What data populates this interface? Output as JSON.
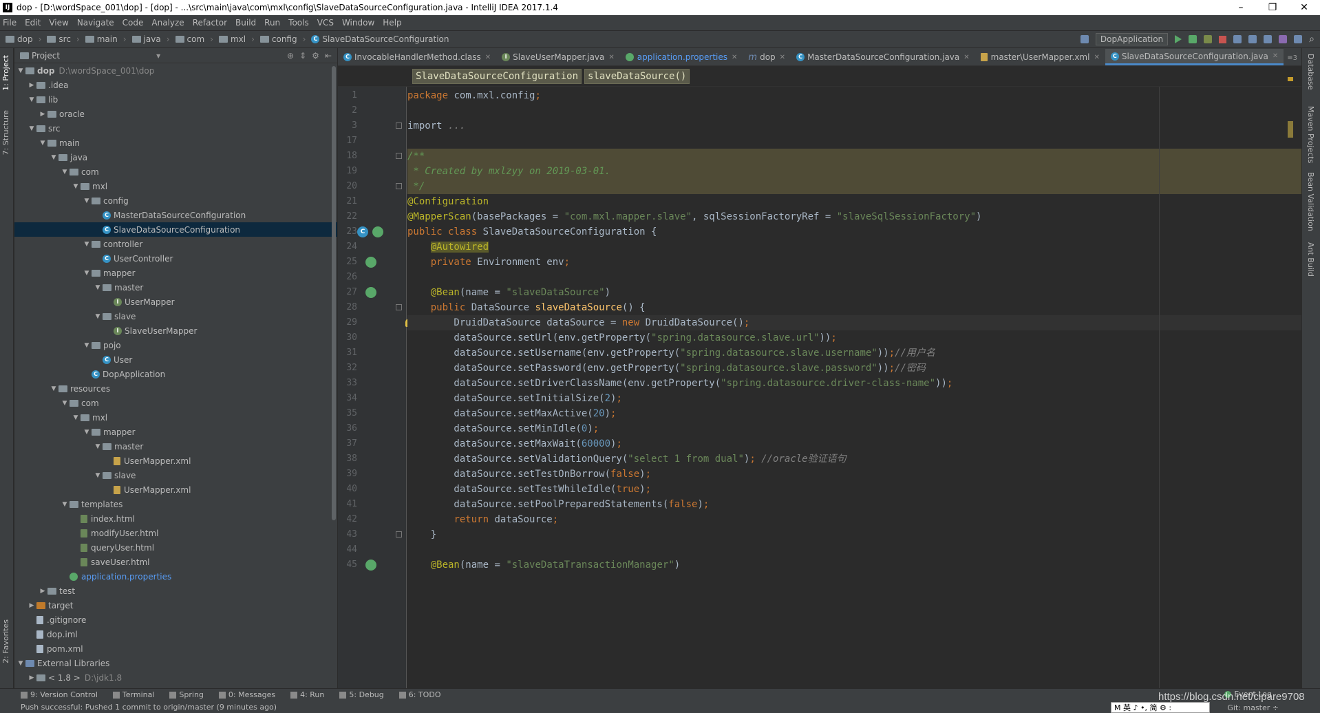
{
  "window": {
    "title": "dop - [D:\\wordSpace_001\\dop] - [dop] - ...\\src\\main\\java\\com\\mxl\\config\\SlaveDataSourceConfiguration.java - IntelliJ IDEA 2017.1.4",
    "app_icon": "IJ"
  },
  "menu": [
    "File",
    "Edit",
    "View",
    "Navigate",
    "Code",
    "Analyze",
    "Refactor",
    "Build",
    "Run",
    "Tools",
    "VCS",
    "Window",
    "Help"
  ],
  "breadcrumbs": [
    "dop",
    "src",
    "main",
    "java",
    "com",
    "mxl",
    "config",
    "SlaveDataSourceConfiguration"
  ],
  "run_config": "DopApplication",
  "project_panel": {
    "title": "Project",
    "tree": [
      {
        "label": "dop",
        "path": "D:\\wordSpace_001\\dop",
        "depth": 0,
        "arrow": "▼",
        "icon": "folder",
        "bold": true
      },
      {
        "label": ".idea",
        "depth": 1,
        "arrow": "▶",
        "icon": "folder"
      },
      {
        "label": "lib",
        "depth": 1,
        "arrow": "▼",
        "icon": "folder"
      },
      {
        "label": "oracle",
        "depth": 2,
        "arrow": "▶",
        "icon": "folder"
      },
      {
        "label": "src",
        "depth": 1,
        "arrow": "▼",
        "icon": "folder"
      },
      {
        "label": "main",
        "depth": 2,
        "arrow": "▼",
        "icon": "folder"
      },
      {
        "label": "java",
        "depth": 3,
        "arrow": "▼",
        "icon": "folder"
      },
      {
        "label": "com",
        "depth": 4,
        "arrow": "▼",
        "icon": "folder"
      },
      {
        "label": "mxl",
        "depth": 5,
        "arrow": "▼",
        "icon": "folder"
      },
      {
        "label": "config",
        "depth": 6,
        "arrow": "▼",
        "icon": "folder"
      },
      {
        "label": "MasterDataSourceConfiguration",
        "depth": 7,
        "arrow": "",
        "icon": "class"
      },
      {
        "label": "SlaveDataSourceConfiguration",
        "depth": 7,
        "arrow": "",
        "icon": "class",
        "selected": true
      },
      {
        "label": "controller",
        "depth": 6,
        "arrow": "▼",
        "icon": "folder"
      },
      {
        "label": "UserController",
        "depth": 7,
        "arrow": "",
        "icon": "class"
      },
      {
        "label": "mapper",
        "depth": 6,
        "arrow": "▼",
        "icon": "folder"
      },
      {
        "label": "master",
        "depth": 7,
        "arrow": "▼",
        "icon": "folder"
      },
      {
        "label": "UserMapper",
        "depth": 8,
        "arrow": "",
        "icon": "interface"
      },
      {
        "label": "slave",
        "depth": 7,
        "arrow": "▼",
        "icon": "folder"
      },
      {
        "label": "SlaveUserMapper",
        "depth": 8,
        "arrow": "",
        "icon": "interface"
      },
      {
        "label": "pojo",
        "depth": 6,
        "arrow": "▼",
        "icon": "folder"
      },
      {
        "label": "User",
        "depth": 7,
        "arrow": "",
        "icon": "class"
      },
      {
        "label": "DopApplication",
        "depth": 6,
        "arrow": "",
        "icon": "class"
      },
      {
        "label": "resources",
        "depth": 3,
        "arrow": "▼",
        "icon": "folder"
      },
      {
        "label": "com",
        "depth": 4,
        "arrow": "▼",
        "icon": "folder"
      },
      {
        "label": "mxl",
        "depth": 5,
        "arrow": "▼",
        "icon": "folder"
      },
      {
        "label": "mapper",
        "depth": 6,
        "arrow": "▼",
        "icon": "folder"
      },
      {
        "label": "master",
        "depth": 7,
        "arrow": "▼",
        "icon": "folder"
      },
      {
        "label": "UserMapper.xml",
        "depth": 8,
        "arrow": "",
        "icon": "xml"
      },
      {
        "label": "slave",
        "depth": 7,
        "arrow": "▼",
        "icon": "folder"
      },
      {
        "label": "UserMapper.xml",
        "depth": 8,
        "arrow": "",
        "icon": "xml"
      },
      {
        "label": "templates",
        "depth": 4,
        "arrow": "▼",
        "icon": "folder"
      },
      {
        "label": "index.html",
        "depth": 5,
        "arrow": "",
        "icon": "html"
      },
      {
        "label": "modifyUser.html",
        "depth": 5,
        "arrow": "",
        "icon": "html"
      },
      {
        "label": "queryUser.html",
        "depth": 5,
        "arrow": "",
        "icon": "html"
      },
      {
        "label": "saveUser.html",
        "depth": 5,
        "arrow": "",
        "icon": "html"
      },
      {
        "label": "application.properties",
        "depth": 4,
        "arrow": "",
        "icon": "props",
        "link": true
      },
      {
        "label": "test",
        "depth": 2,
        "arrow": "▶",
        "icon": "folder"
      },
      {
        "label": "target",
        "depth": 1,
        "arrow": "▶",
        "icon": "orangefolder"
      },
      {
        "label": ".gitignore",
        "depth": 1,
        "arrow": "",
        "icon": "file"
      },
      {
        "label": "dop.iml",
        "depth": 1,
        "arrow": "",
        "icon": "file"
      },
      {
        "label": "pom.xml",
        "depth": 1,
        "arrow": "",
        "icon": "file"
      },
      {
        "label": "External Libraries",
        "depth": 0,
        "arrow": "▼",
        "icon": "lib"
      },
      {
        "label": "< 1.8 >",
        "path": "D:\\jdk1.8",
        "depth": 1,
        "arrow": "▶",
        "icon": "folder"
      }
    ]
  },
  "tabs": [
    {
      "label": "InvocableHandlerMethod.class",
      "icon": "class"
    },
    {
      "label": "SlaveUserMapper.java",
      "icon": "interface"
    },
    {
      "label": "application.properties",
      "icon": "props"
    },
    {
      "label": "dop",
      "icon": "m"
    },
    {
      "label": "MasterDataSourceConfiguration.java",
      "icon": "class"
    },
    {
      "label": "master\\UserMapper.xml",
      "icon": "xml"
    },
    {
      "label": "SlaveDataSourceConfiguration.java",
      "icon": "class",
      "active": true
    }
  ],
  "tabs_overflow": "≡3",
  "editor_breadcrumb": [
    "SlaveDataSourceConfiguration",
    "slaveDataSource()"
  ],
  "line_numbers": [
    "1",
    "2",
    "3",
    "17",
    "18",
    "19",
    "20",
    "21",
    "22",
    "23",
    "24",
    "25",
    "26",
    "27",
    "28",
    "29",
    "30",
    "31",
    "32",
    "33",
    "34",
    "35",
    "36",
    "37",
    "38",
    "39",
    "40",
    "41",
    "42",
    "43",
    "44",
    "45"
  ],
  "code_lines": [
    [
      [
        "k",
        "package "
      ],
      [
        "",
        "com.mxl.config"
      ],
      [
        "k",
        ";"
      ]
    ],
    [],
    [
      [
        "",
        "import "
      ],
      [
        "c",
        "..."
      ]
    ],
    [],
    [
      [
        "cc",
        "/**"
      ]
    ],
    [
      [
        "cc",
        " * Created by mxlzyy on 2019-03-01."
      ]
    ],
    [
      [
        "cc",
        " */"
      ]
    ],
    [
      [
        "a",
        "@Configuration"
      ]
    ],
    [
      [
        "a",
        "@MapperScan"
      ],
      [
        "",
        "(basePackages = "
      ],
      [
        "s",
        "\"com.mxl.mapper.slave\""
      ],
      [
        "",
        ", sqlSessionFactoryRef = "
      ],
      [
        "s",
        "\"slaveSqlSessionFactory\""
      ],
      [
        "",
        ")"
      ]
    ],
    [
      [
        "k",
        "public class "
      ],
      [
        "",
        "SlaveDataSourceConfiguration {"
      ]
    ],
    [
      [
        "",
        "    "
      ],
      [
        "aw",
        "@Autowired"
      ]
    ],
    [
      [
        "",
        "    "
      ],
      [
        "k",
        "private "
      ],
      [
        "",
        "Environment env"
      ],
      [
        "k",
        ";"
      ]
    ],
    [],
    [
      [
        "",
        "    "
      ],
      [
        "a",
        "@Bean"
      ],
      [
        "",
        "(name = "
      ],
      [
        "s",
        "\"slaveDataSource\""
      ],
      [
        "",
        ")"
      ]
    ],
    [
      [
        "",
        "    "
      ],
      [
        "k",
        "public "
      ],
      [
        "",
        "DataSource "
      ],
      [
        "f",
        "slaveDataSource"
      ],
      [
        "",
        "() {"
      ]
    ],
    [
      [
        "",
        "        DruidDataSource dataSource = "
      ],
      [
        "k",
        "new "
      ],
      [
        "",
        "DruidDataSource()"
      ],
      [
        "k",
        ";"
      ]
    ],
    [
      [
        "",
        "        dataSource.setUrl(env.getProperty("
      ],
      [
        "s",
        "\"spring.datasource.slave.url\""
      ],
      [
        "",
        "))"
      ],
      [
        "k",
        ";"
      ]
    ],
    [
      [
        "",
        "        dataSource.setUsername(env.getProperty("
      ],
      [
        "s",
        "\"spring.datasource.slave.username\""
      ],
      [
        "",
        "))"
      ],
      [
        "k",
        ";"
      ],
      [
        "c",
        "//用户名"
      ]
    ],
    [
      [
        "",
        "        dataSource.setPassword(env.getProperty("
      ],
      [
        "s",
        "\"spring.datasource.slave.password\""
      ],
      [
        "",
        "))"
      ],
      [
        "k",
        ";"
      ],
      [
        "c",
        "//密码"
      ]
    ],
    [
      [
        "",
        "        dataSource.setDriverClassName(env.getProperty("
      ],
      [
        "s",
        "\"spring.datasource.driver-class-name\""
      ],
      [
        "",
        "))"
      ],
      [
        "k",
        ";"
      ]
    ],
    [
      [
        "",
        "        dataSource.setInitialSize("
      ],
      [
        "n",
        "2"
      ],
      [
        "",
        ")"
      ],
      [
        "k",
        ";"
      ]
    ],
    [
      [
        "",
        "        dataSource.setMaxActive("
      ],
      [
        "n",
        "20"
      ],
      [
        "",
        ")"
      ],
      [
        "k",
        ";"
      ]
    ],
    [
      [
        "",
        "        dataSource.setMinIdle("
      ],
      [
        "n",
        "0"
      ],
      [
        "",
        ")"
      ],
      [
        "k",
        ";"
      ]
    ],
    [
      [
        "",
        "        dataSource.setMaxWait("
      ],
      [
        "n",
        "60000"
      ],
      [
        "",
        ")"
      ],
      [
        "k",
        ";"
      ]
    ],
    [
      [
        "",
        "        dataSource.setValidationQuery("
      ],
      [
        "s",
        "\"select 1 from dual\""
      ],
      [
        "",
        ")"
      ],
      [
        "k",
        "; "
      ],
      [
        "c",
        "//oracle验证语句"
      ]
    ],
    [
      [
        "",
        "        dataSource.setTestOnBorrow("
      ],
      [
        "k",
        "false"
      ],
      [
        "",
        ")"
      ],
      [
        "k",
        ";"
      ]
    ],
    [
      [
        "",
        "        dataSource.setTestWhileIdle("
      ],
      [
        "k",
        "true"
      ],
      [
        "",
        ")"
      ],
      [
        "k",
        ";"
      ]
    ],
    [
      [
        "",
        "        dataSource.setPoolPreparedStatements("
      ],
      [
        "k",
        "false"
      ],
      [
        "",
        ")"
      ],
      [
        "k",
        ";"
      ]
    ],
    [
      [
        "",
        "        "
      ],
      [
        "k",
        "return "
      ],
      [
        "",
        "dataSource"
      ],
      [
        "k",
        ";"
      ]
    ],
    [
      [
        "",
        "    }"
      ]
    ],
    [],
    [
      [
        "",
        "    "
      ],
      [
        "a",
        "@Bean"
      ],
      [
        "",
        "(name = "
      ],
      [
        "s",
        "\"slaveDataTransactionManager\""
      ],
      [
        "",
        ")"
      ]
    ]
  ],
  "left_tool_tabs": [
    "1: Project",
    "7: Structure",
    "2: Favorites"
  ],
  "right_tool_tabs": [
    "Database",
    "Maven Projects",
    "Bean Validation",
    "Ant Build"
  ],
  "bottom_tools": [
    {
      "label": "9: Version Control",
      "icon": "vcs-icon"
    },
    {
      "label": "Terminal",
      "icon": "terminal-icon"
    },
    {
      "label": "Spring",
      "icon": "spring-icon"
    },
    {
      "label": "0: Messages",
      "icon": "messages-icon"
    },
    {
      "label": "4: Run",
      "icon": "run-icon"
    },
    {
      "label": "5: Debug",
      "icon": "debug-icon"
    },
    {
      "label": "6: TODO",
      "icon": "todo-icon"
    }
  ],
  "event_log": "Event Log",
  "status": "Push successful: Pushed 1 commit to origin/master (9 minutes ago)",
  "git_branch": "Git: master ÷",
  "watermark": "https://blog.csdn.net/cipare9708",
  "ime": "M 英 ♪ •, 简 ⚙ :",
  "colors": {
    "accent": "#4a88c7",
    "keyword": "#cc7832",
    "string": "#6a8759",
    "annotation": "#bbb529",
    "number": "#6897bb",
    "selection": "#0d293e"
  }
}
